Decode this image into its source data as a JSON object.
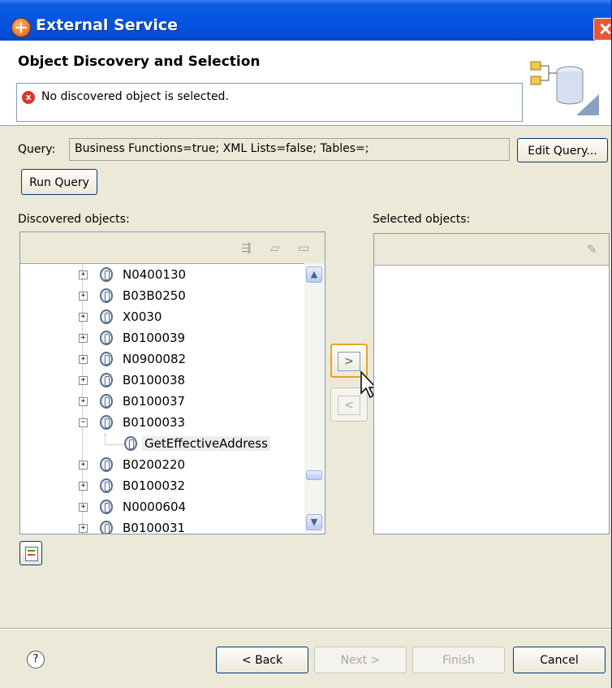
{
  "window": {
    "title": "External Service"
  },
  "header": {
    "title": "Object Discovery and Selection",
    "message": "No discovered object is selected."
  },
  "query": {
    "label": "Query:",
    "value": "Business Functions=true; XML Lists=false; Tables=;",
    "edit_button": "Edit Query...",
    "run_button": "Run Query"
  },
  "discovered": {
    "label": "Discovered objects:",
    "items": [
      {
        "label": "N0400130",
        "expanded": false
      },
      {
        "label": "B03B0250",
        "expanded": false
      },
      {
        "label": "X0030",
        "expanded": false
      },
      {
        "label": "B0100039",
        "expanded": false
      },
      {
        "label": "N0900082",
        "expanded": false
      },
      {
        "label": "B0100038",
        "expanded": false
      },
      {
        "label": "B0100037",
        "expanded": false
      },
      {
        "label": "B0100033",
        "expanded": true
      },
      {
        "label": "GetEffectiveAddress",
        "child": true
      },
      {
        "label": "B0200220",
        "expanded": false
      },
      {
        "label": "B0100032",
        "expanded": false
      },
      {
        "label": "N0000604",
        "expanded": false
      },
      {
        "label": "B0100031",
        "expanded": false
      }
    ]
  },
  "selected": {
    "label": "Selected objects:"
  },
  "arrows": {
    "add": ">",
    "remove": "<"
  },
  "footer": {
    "help": "?",
    "back": "< Back",
    "next": "Next >",
    "finish": "Finish",
    "cancel": "Cancel"
  },
  "colors": {
    "titlebar": "#0554e3",
    "accent_focus": "#e6a32a",
    "error": "#d53a2a"
  }
}
